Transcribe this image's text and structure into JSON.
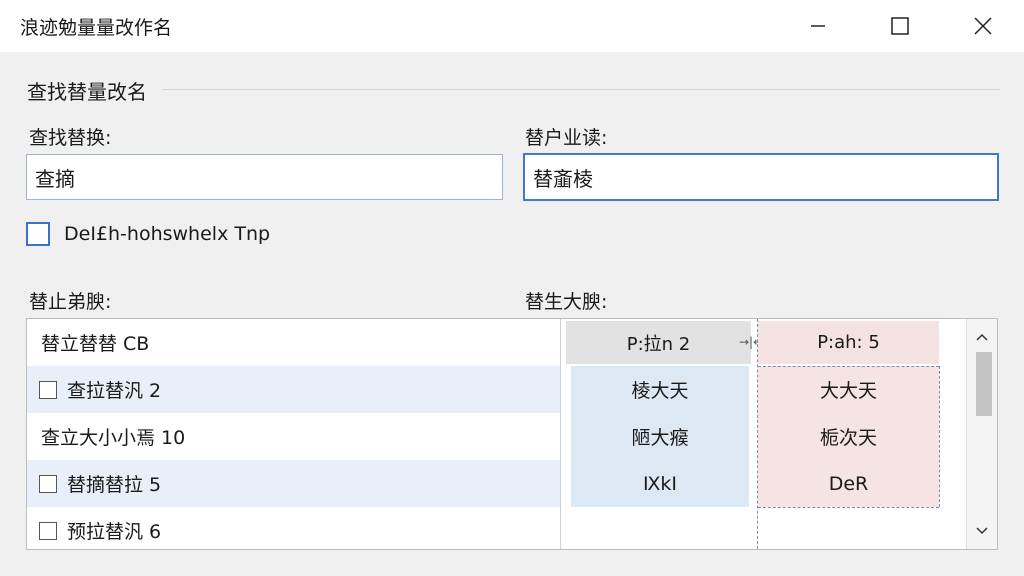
{
  "window": {
    "title": "浪迹勉量量改作名"
  },
  "section": {
    "title": "查找替量改名"
  },
  "find": {
    "label": "查找替换:",
    "value": "查摘"
  },
  "replace": {
    "label": "替户业读:",
    "value": "替齑棱"
  },
  "option": {
    "label": "DeI£h-hohswhelx Tnp",
    "checked": false
  },
  "original": {
    "label": "替止弟腴:",
    "rows": [
      {
        "text": "替立替替 CB",
        "has_checkbox": false
      },
      {
        "text": "查拉替汎 2",
        "has_checkbox": true
      },
      {
        "text": "查立大小小焉 10",
        "has_checkbox": false
      },
      {
        "text": "替摘替拉 5",
        "has_checkbox": true
      },
      {
        "text": "预拉替汎 6",
        "has_checkbox": true
      }
    ]
  },
  "preview": {
    "label": "替生大腴:",
    "headers": [
      "P:拉n 2",
      "P:ah: 5"
    ],
    "col_a": [
      "棱大天",
      "陋大瘊",
      "ⅨkⅠ"
    ],
    "col_b": [
      "大大天",
      "栀次天",
      "DeR"
    ]
  },
  "colors": {
    "accent": "#3c7bd1",
    "row_alt": "#e9eff8",
    "preview_a": "#dde8f5",
    "preview_b": "#f5e4e3"
  }
}
